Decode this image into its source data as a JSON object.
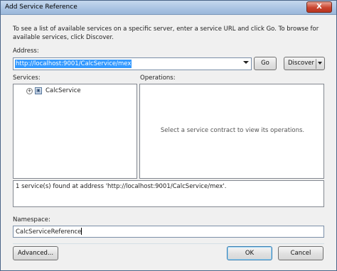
{
  "window": {
    "title": "Add Service Reference",
    "close_glyph": "X"
  },
  "intro_text": "To see a list of available services on a specific server, enter a service URL and click Go. To browse for available services, click Discover.",
  "address": {
    "label": "Address:",
    "value": "http://localhost:9001/CalcService/mex",
    "go_label": "Go",
    "discover_label": "Discover"
  },
  "services": {
    "label": "Services:",
    "items": [
      {
        "label": "CalcService",
        "expander": "+",
        "icon": "service-reference-icon"
      }
    ]
  },
  "operations": {
    "label": "Operations:",
    "message": "Select a service contract to view its operations."
  },
  "status_text": "1 service(s) found at address 'http://localhost:9001/CalcService/mex'.",
  "namespace": {
    "label": "Namespace:",
    "value": "CalcServiceReference"
  },
  "buttons": {
    "advanced": "Advanced...",
    "ok": "OK",
    "cancel": "Cancel"
  },
  "colors": {
    "selection": "#3399ff",
    "title_bar": "#a9c3e2",
    "close_button": "#c9452f"
  }
}
